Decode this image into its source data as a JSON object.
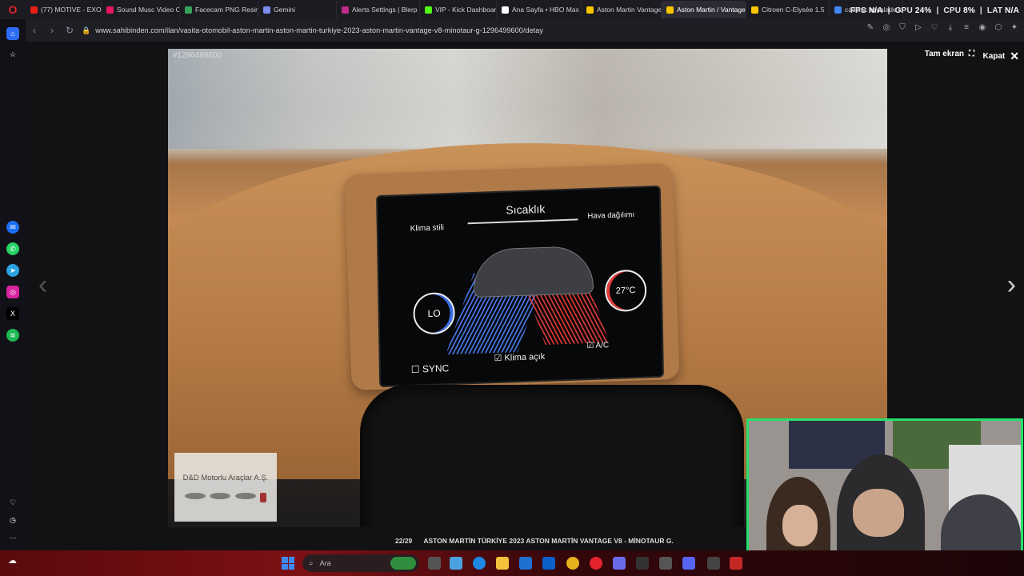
{
  "browser": {
    "tabs": [
      {
        "label": "(77) MOTIVE - EXORC",
        "color": "#e62117"
      },
      {
        "label": "Sound Musc Video C",
        "color": "#e6175f"
      },
      {
        "label": "Facecam PNG Resim",
        "color": "#3aa35a"
      },
      {
        "label": "Gemini",
        "color": "#7b8cf0"
      },
      {
        "label": "Alerts Settings | Blerp",
        "color": "#c02a8a"
      },
      {
        "label": "VIP - Kick Dashboard",
        "color": "#53fc18"
      },
      {
        "label": "Ana Sayfa • HBO Max",
        "color": "#ffffff"
      },
      {
        "label": "Aston Martin Vantage",
        "color": "#f7c600"
      },
      {
        "label": "Aston Martin / Vantage /",
        "color": "#f7c600",
        "active": true
      },
      {
        "label": "Citroen C-Elysée 1.5",
        "color": "#f7c600"
      },
      {
        "label": "cadillac escalade ka",
        "color": "#4285f4"
      }
    ],
    "url": "www.sahibinden.com/ilan/vasita-otomobil-aston-martin-aston-martin-turkiye-2023-aston-martin-vantage-v8-minotaur-g-1296499600/detay"
  },
  "hud": {
    "fps_label": "FPS",
    "fps_value": "N/A",
    "gpu_label": "GPU",
    "gpu_value": "24%",
    "cpu_label": "CPU",
    "cpu_value": "8%",
    "lat_label": "LAT",
    "lat_value": "N/A"
  },
  "lightbox": {
    "photo_id": "#1296499600",
    "fullscreen_label": "Tam ekran",
    "close_label": "Kapat",
    "counter": "22/29",
    "caption": "ASTON MARTİN TÜRKİYE 2023 ASTON MARTİN VANTAGE V8 - MİNOTAUR G."
  },
  "infotainment": {
    "title": "Sıcaklık",
    "left_label": "Klima stili",
    "right_label": "Hava dağılımı",
    "left_dial": "LO",
    "right_dial": "27°C",
    "sync": "SYNC",
    "klima": "Klima açık",
    "ac": "A/C"
  },
  "dealer": {
    "name": "D&D Motorlu Araçlar A.Ş."
  },
  "taskbar": {
    "search_placeholder": "Ara"
  },
  "colors": {
    "webcam_border": "#25e06a",
    "accent_red": "#e3232c"
  }
}
